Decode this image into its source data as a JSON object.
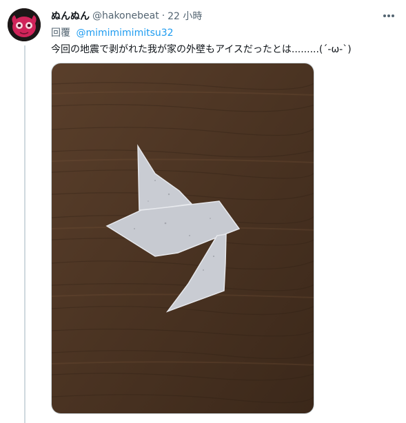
{
  "tweet": {
    "display_name": "ぬんぬん",
    "handle": "@hakonebeat",
    "separator": "·",
    "time": "22 小時",
    "replying_label": "回覆",
    "replying_to": "@mimimimimitsu32",
    "text": "今回の地震で剥がれた我が家の外壁もアイスだったとは.........(´-ω-`)"
  },
  "icons": {
    "more": "more-horizontal-icon",
    "avatar": "avatar-image"
  },
  "colors": {
    "link": "#1d9bf0",
    "secondary_text": "#536471",
    "wood_base": "#4a3322"
  }
}
